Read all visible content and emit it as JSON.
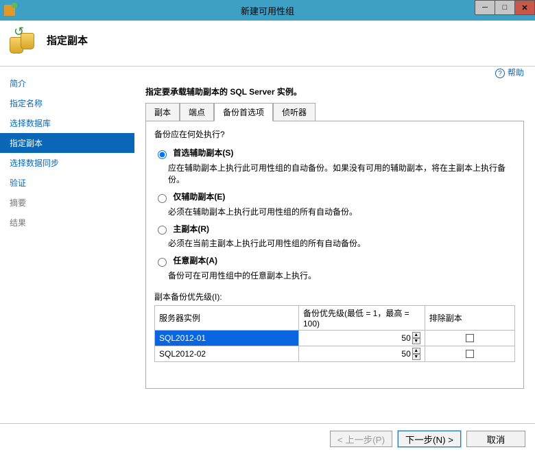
{
  "window": {
    "title": "新建可用性组"
  },
  "header": {
    "title": "指定副本"
  },
  "help": {
    "label": "帮助"
  },
  "sidebar": {
    "items": [
      {
        "label": "简介"
      },
      {
        "label": "指定名称"
      },
      {
        "label": "选择数据库"
      },
      {
        "label": "指定副本"
      },
      {
        "label": "选择数据同步"
      },
      {
        "label": "验证"
      },
      {
        "label": "摘要"
      },
      {
        "label": "结果"
      }
    ]
  },
  "main": {
    "instruction": "指定要承载辅助副本的 SQL Server 实例。",
    "tabs": [
      {
        "label": "副本"
      },
      {
        "label": "端点"
      },
      {
        "label": "备份首选项"
      },
      {
        "label": "侦听器"
      }
    ],
    "panel": {
      "question": "备份应在何处执行?",
      "options": [
        {
          "label": "首选辅助副本(S)",
          "desc": "应在辅助副本上执行此可用性组的自动备份。如果没有可用的辅助副本，将在主副本上执行备份。"
        },
        {
          "label": "仅辅助副本(E)",
          "desc": "必须在辅助副本上执行此可用性组的所有自动备份。"
        },
        {
          "label": "主副本(R)",
          "desc": "必须在当前主副本上执行此可用性组的所有自动备份。"
        },
        {
          "label": "任意副本(A)",
          "desc": "备份可在可用性组中的任意副本上执行。"
        }
      ],
      "priority_label": "副本备份优先级(I):",
      "table": {
        "cols": [
          "服务器实例",
          "备份优先级(最低 = 1，最高 = 100)",
          "排除副本"
        ],
        "rows": [
          {
            "server": "SQL2012-01",
            "priority": "50",
            "exclude": false
          },
          {
            "server": "SQL2012-02",
            "priority": "50",
            "exclude": false
          }
        ]
      }
    }
  },
  "footer": {
    "prev": "< 上一步(P)",
    "next": "下一步(N) >",
    "cancel": "取消"
  }
}
